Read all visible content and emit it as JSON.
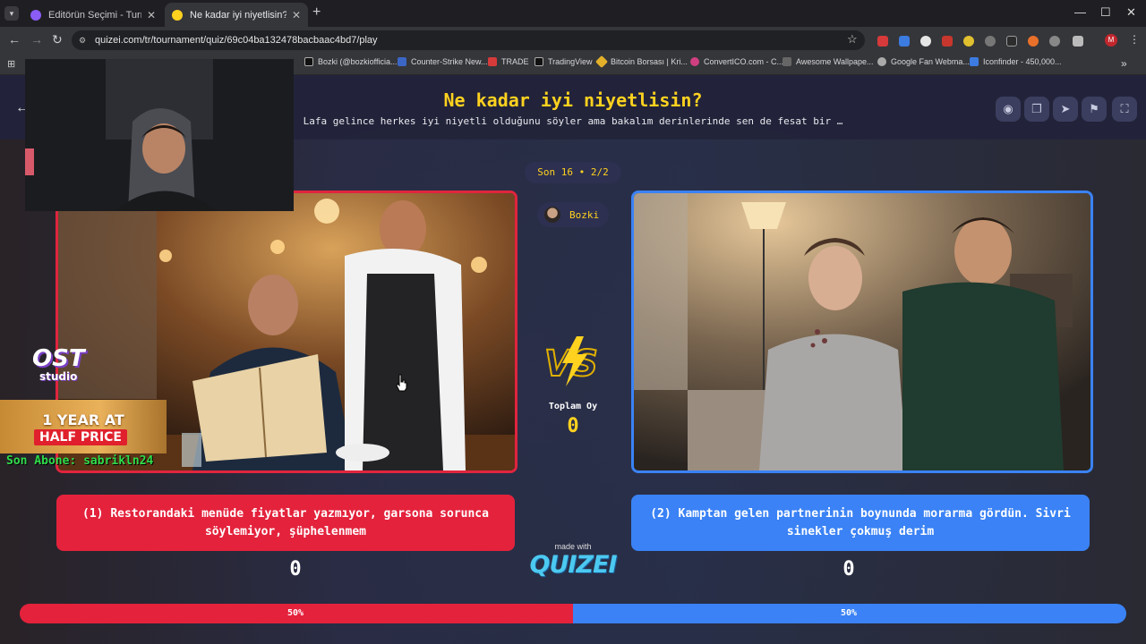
{
  "browser": {
    "tabs": [
      {
        "title": "Editörün Seçimi - Turnuva - Qu",
        "favicon_color": "#8b5cf6"
      },
      {
        "title": "Ne kadar iyi niyetlisin? - Tier Li",
        "favicon_color": "#ffd21f"
      }
    ],
    "url": "quizei.com/tr/tournament/quiz/69c04ba132478bacbaac4bd7/play",
    "profile_initial": "M",
    "bookmarks": [
      "Bozki (@bozkiofficia...",
      "Counter-Strike New...",
      "TRADE",
      "TradingView",
      "Bitcoin Borsası | Kri...",
      "ConvertICO.com - C...",
      "Awesome Wallpape...",
      "Google Fan Webma...",
      "Iconfinder - 450,000..."
    ]
  },
  "quiz": {
    "title": "Ne kadar iyi niyetlisin?",
    "description": "Lafa gelince herkes iyi niyetli olduğunu söyler ama bakalım derinlerinde sen de fesat bir …",
    "round": "Son 16 • 2/2",
    "user": "Bozki",
    "total_label": "Toplam Oy",
    "total_value": "0",
    "made_with": "made with",
    "brand": "QUIZEI"
  },
  "options": {
    "left": {
      "label": "(1) Restorandaki menüde fiyatlar yazmıyor, garsona sorunca söylemiyor, şüphelenmem",
      "votes": "0",
      "percent_label": "50%",
      "share": 0.5,
      "color": "#e4223c"
    },
    "right": {
      "label": "(2) Kamptan gelen partnerinin boynunda morarma gördün. Sivri sinekler çokmuş derim",
      "votes": "0",
      "percent_label": "50%",
      "share": 0.5,
      "color": "#3a82f5"
    }
  },
  "overlay": {
    "logo_main": "OST",
    "logo_sub": "studio",
    "promo_line1": "1 YEAR AT",
    "promo_line2": "HALF PRICE",
    "sub_alert": "Son Abone: sabrikln24"
  }
}
